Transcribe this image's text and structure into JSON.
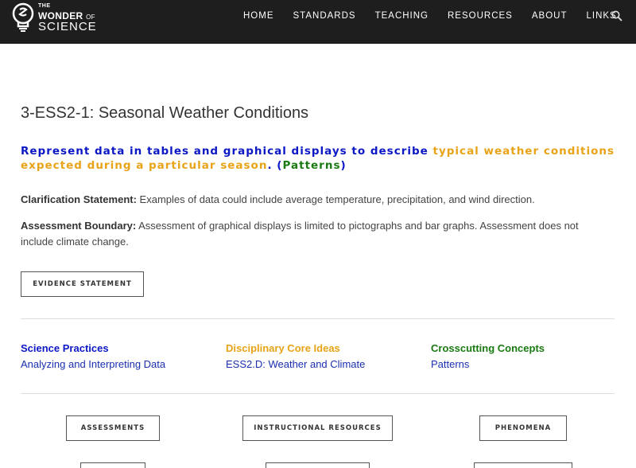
{
  "nav": {
    "logo": {
      "the": "THE",
      "wonder": "WONDER",
      "of": "OF",
      "science": "SCIENCE"
    },
    "items": [
      "HOME",
      "STANDARDS",
      "TEACHING",
      "RESOURCES",
      "ABOUT",
      "LINKS"
    ],
    "search_icon": "search-icon"
  },
  "page": {
    "title": "3-ESS2-1: Seasonal Weather Conditions",
    "performance_expectation": {
      "practice": "Represent data in tables and graphical displays to describe",
      "core_idea": "typical weather conditions expected during a particular season",
      "period": ".",
      "open_paren": "(",
      "crosscutting": "Patterns",
      "close_paren": ")"
    },
    "clarification": {
      "label": "Clarification Statement:",
      "text": "Examples of data could include average temperature, precipitation, and wind direction."
    },
    "assessment_boundary": {
      "label": "Assessment Boundary:",
      "text": "Assessment of graphical displays is limited to pictographs and bar graphs. Assessment does not include climate change."
    },
    "evidence_button": "EVIDENCE STATEMENT",
    "dimensions": {
      "practices": {
        "heading": "Science Practices",
        "link": "Analyzing and Interpreting Data"
      },
      "core_ideas": {
        "heading": "Disciplinary Core Ideas",
        "link": "ESS2.D: Weather and Climate"
      },
      "crosscutting": {
        "heading": "Crosscutting Concepts",
        "link": "Patterns"
      }
    },
    "resource_buttons": [
      "ASSESSMENTS",
      "INSTRUCTIONAL RESOURCES",
      "PHENOMENA"
    ]
  },
  "colors": {
    "nav_bg": "#1e1e1e",
    "practice_blue": "#0b17c5",
    "core_orange": "#e8a317",
    "crosscutting_green": "#1a7a12"
  }
}
